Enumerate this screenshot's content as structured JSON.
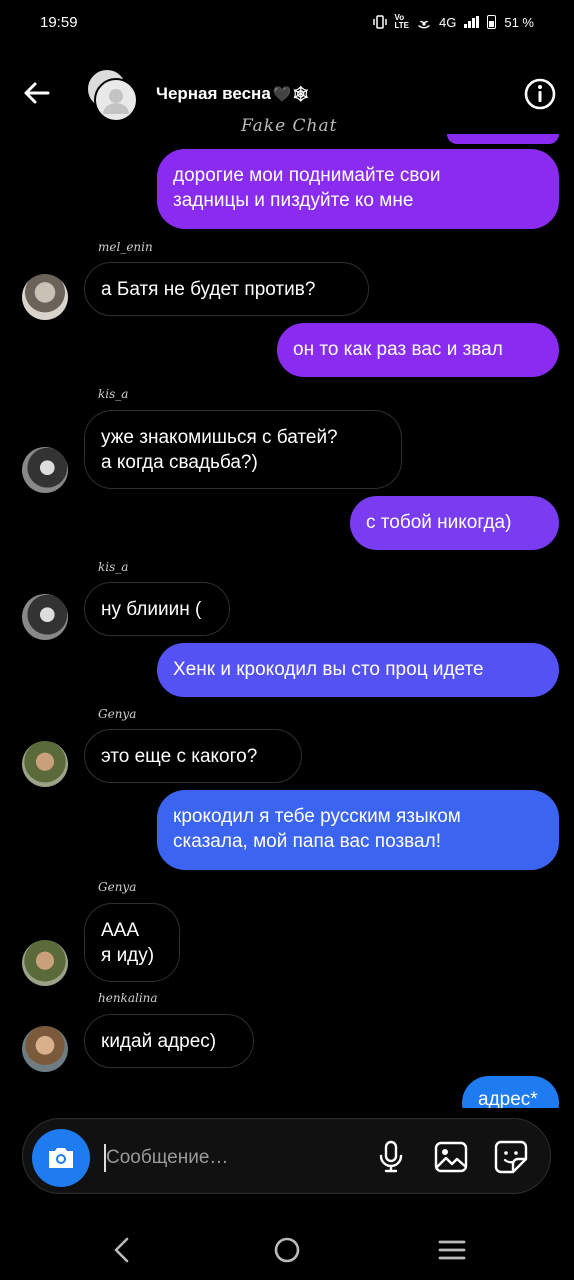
{
  "status_bar": {
    "time": "19:59",
    "network": "4G",
    "battery": "51 %",
    "icons": [
      "vibrate-icon",
      "volte-icon",
      "hotspot-icon",
      "signal-icon",
      "battery-icon"
    ]
  },
  "header": {
    "title": "Черная весна",
    "title_emojis": "🖤🕸",
    "watermark": "Fake Chat",
    "icons": [
      "back-arrow-icon",
      "group-avatar",
      "info-icon"
    ]
  },
  "colors": {
    "purple": "#8a2cf0",
    "violet": "#7a3cf0",
    "indigo": "#5452f2",
    "blue": "#3b64f0",
    "accent_camera": "#1e7cf0",
    "incoming_border": "#2f2f2f"
  },
  "messages": [
    {
      "dir": "out",
      "text": "дорогие мои поднимайте свои\nзадницы и пиздуйте ко мне"
    },
    {
      "dir": "in",
      "sender": "mel_enin",
      "text": "а Батя не будет против?"
    },
    {
      "dir": "out",
      "text": "он то как раз вас и звал"
    },
    {
      "dir": "in",
      "sender": "kis_a",
      "text": "уже знакомишься с батей?\nа когда свадьба?)"
    },
    {
      "dir": "out",
      "text": "с тобой никогда)"
    },
    {
      "dir": "in",
      "sender": "kis_a",
      "text": "ну блииин ("
    },
    {
      "dir": "out",
      "text": "Хенк и крокодил вы сто проц идете"
    },
    {
      "dir": "in",
      "sender": "Genya",
      "text": "это еще с какого?"
    },
    {
      "dir": "out",
      "text": "крокодил я тебе русским языком\nсказала, мой папа вас позвал!"
    },
    {
      "dir": "in",
      "sender": "Genya",
      "text": "ААА\nя иду)"
    },
    {
      "dir": "in",
      "sender": "henkalina",
      "text": "кидай адрес)"
    },
    {
      "dir": "out",
      "text": "адрес*"
    }
  ],
  "composer": {
    "placeholder": "Сообщение…",
    "icons": [
      "camera-icon",
      "microphone-icon",
      "gallery-icon",
      "sticker-icon"
    ]
  },
  "nav_bar": {
    "icons": [
      "back-nav-icon",
      "home-nav-icon",
      "recents-nav-icon"
    ]
  }
}
